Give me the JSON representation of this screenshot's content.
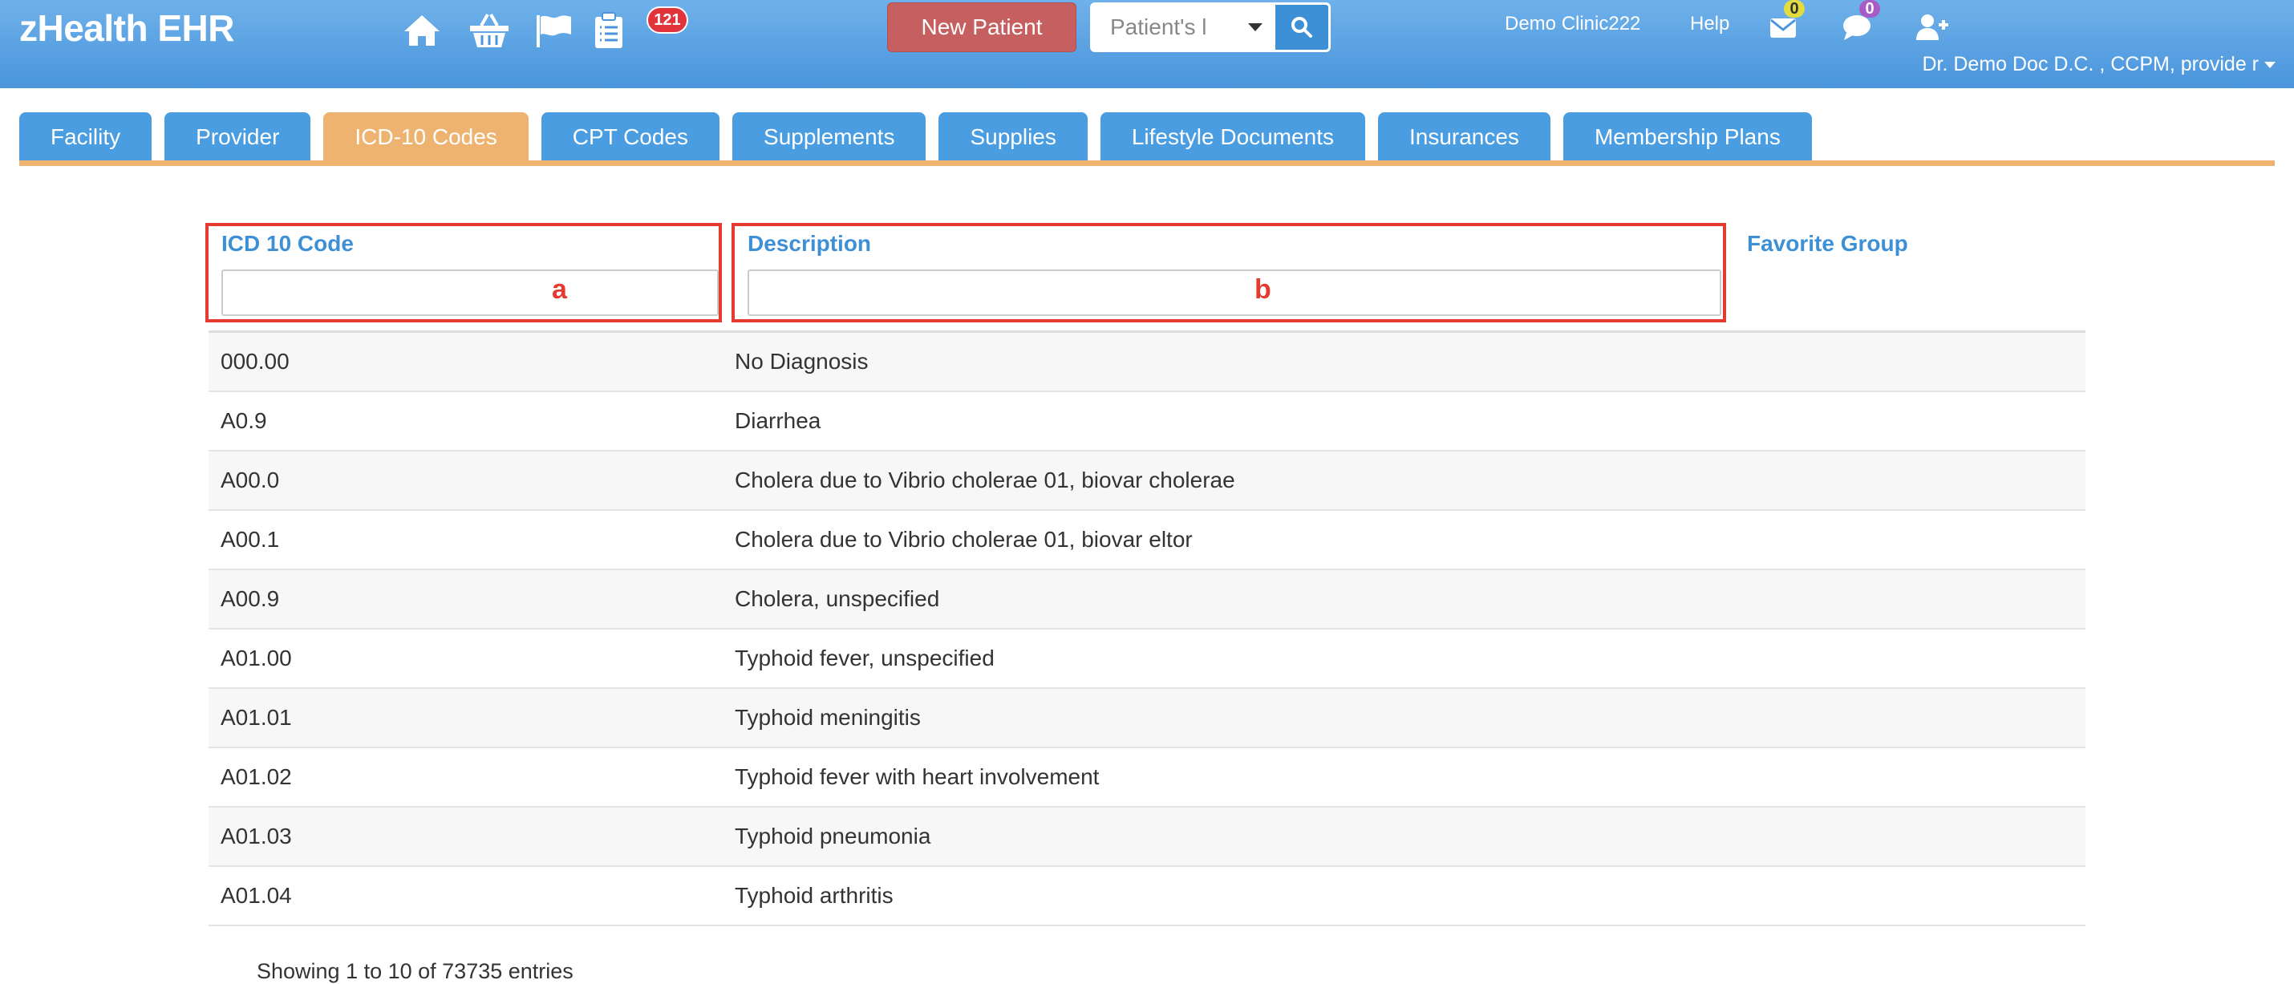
{
  "app": {
    "title": "zHealth EHR"
  },
  "header": {
    "notification_count": "121",
    "new_patient_label": "New Patient",
    "search_placeholder": "Patient's l",
    "clinic_name": "Demo Clinic222",
    "help_label": "Help",
    "mail_count": "0",
    "chat_count": "0",
    "user_label": "Dr. Demo Doc D.C. , CCPM, provide r",
    "colors": {
      "bar": "#4a95dc",
      "new_patient": "#c65f5f",
      "badge_red": "#e0333a"
    }
  },
  "tabs": [
    {
      "label": "Facility",
      "active": false
    },
    {
      "label": "Provider",
      "active": false
    },
    {
      "label": "ICD-10 Codes",
      "active": true
    },
    {
      "label": "CPT Codes",
      "active": false
    },
    {
      "label": "Supplements",
      "active": false
    },
    {
      "label": "Supplies",
      "active": false
    },
    {
      "label": "Lifestyle Documents",
      "active": false
    },
    {
      "label": "Insurances",
      "active": false
    },
    {
      "label": "Membership Plans",
      "active": false
    }
  ],
  "table": {
    "columns": {
      "code": "ICD 10 Code",
      "description": "Description",
      "favorite": "Favorite Group"
    },
    "markers": {
      "code": "a",
      "description": "b"
    },
    "rows": [
      {
        "code": "000.00",
        "description": "No Diagnosis"
      },
      {
        "code": "A0.9",
        "description": "Diarrhea"
      },
      {
        "code": "A00.0",
        "description": "Cholera due to Vibrio cholerae 01, biovar cholerae"
      },
      {
        "code": "A00.1",
        "description": "Cholera due to Vibrio cholerae 01, biovar eltor"
      },
      {
        "code": "A00.9",
        "description": "Cholera, unspecified"
      },
      {
        "code": "A01.00",
        "description": "Typhoid fever, unspecified"
      },
      {
        "code": "A01.01",
        "description": "Typhoid meningitis"
      },
      {
        "code": "A01.02",
        "description": "Typhoid fever with heart involvement"
      },
      {
        "code": "A01.03",
        "description": "Typhoid pneumonia"
      },
      {
        "code": "A01.04",
        "description": "Typhoid arthritis"
      }
    ],
    "info": "Showing 1 to 10 of 73735 entries"
  }
}
